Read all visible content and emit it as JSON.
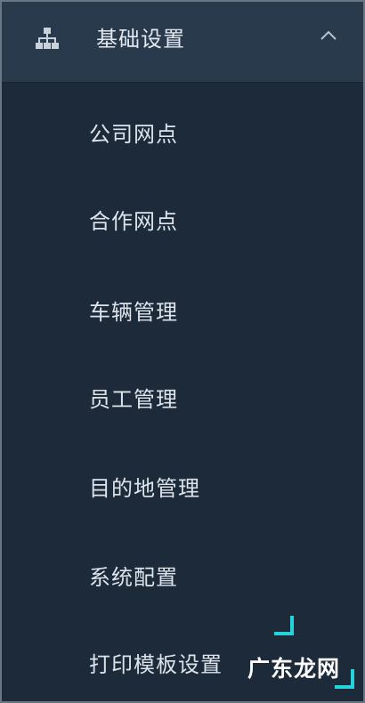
{
  "menu": {
    "group_label": "基础设置",
    "group_icon": "org-chart-icon",
    "expanded": true,
    "items": [
      {
        "label": "公司网点"
      },
      {
        "label": "合作网点"
      },
      {
        "label": "车辆管理"
      },
      {
        "label": "员工管理"
      },
      {
        "label": "目的地管理"
      },
      {
        "label": "系统配置"
      },
      {
        "label": "打印模板设置"
      }
    ]
  },
  "watermark": {
    "text": "广东龙网"
  },
  "colors": {
    "panel_bg": "#1c2a3a",
    "header_bg": "#2a3a4d",
    "text": "#dde3ea",
    "watermark_accent": "#26d3d8"
  }
}
